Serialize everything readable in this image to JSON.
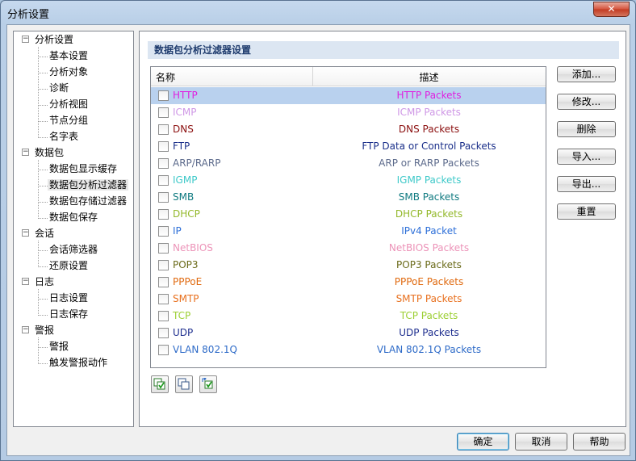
{
  "window": {
    "title": "分析设置",
    "close_label": "✕"
  },
  "tree": {
    "groups": [
      {
        "label": "分析设置",
        "children": [
          "基本设置",
          "分析对象",
          "诊断",
          "分析视图",
          "节点分组",
          "名字表"
        ]
      },
      {
        "label": "数据包",
        "children": [
          "数据包显示缓存",
          "数据包分析过滤器",
          "数据包存储过滤器",
          "数据包保存"
        ]
      },
      {
        "label": "会话",
        "children": [
          "会话筛选器",
          "还原设置"
        ]
      },
      {
        "label": "日志",
        "children": [
          "日志设置",
          "日志保存"
        ]
      },
      {
        "label": "警报",
        "children": [
          "警报",
          "触发警报动作"
        ]
      }
    ],
    "selected": "数据包分析过滤器"
  },
  "panel": {
    "header": "数据包分析过滤器设置",
    "columns": {
      "name": "名称",
      "desc": "描述"
    },
    "rows": [
      {
        "name": "HTTP",
        "desc": "HTTP Packets",
        "color": "#e020e0",
        "selected": true
      },
      {
        "name": "ICMP",
        "desc": "ICMP Packets",
        "color": "#cf98e6"
      },
      {
        "name": "DNS",
        "desc": "DNS Packets",
        "color": "#8b0f0f"
      },
      {
        "name": "FTP",
        "desc": "FTP Data or Control Packets",
        "color": "#1a2f8a"
      },
      {
        "name": "ARP/RARP",
        "desc": "ARP or RARP Packets",
        "color": "#5d6b8c"
      },
      {
        "name": "IGMP",
        "desc": "IGMP Packets",
        "color": "#3fc9c9"
      },
      {
        "name": "SMB",
        "desc": "SMB Packets",
        "color": "#0f7a80"
      },
      {
        "name": "DHCP",
        "desc": "DHCP Packets",
        "color": "#93b82a"
      },
      {
        "name": "IP",
        "desc": "IPv4 Packet",
        "color": "#2d6fd8"
      },
      {
        "name": "NetBIOS",
        "desc": "NetBIOS Packets",
        "color": "#ec93b8"
      },
      {
        "name": "POP3",
        "desc": "POP3 Packets",
        "color": "#6b6b1a"
      },
      {
        "name": "PPPoE",
        "desc": "PPPoE Packets",
        "color": "#e06a10"
      },
      {
        "name": "SMTP",
        "desc": "SMTP Packets",
        "color": "#e8701e"
      },
      {
        "name": "TCP",
        "desc": "TCP Packets",
        "color": "#9ccf33"
      },
      {
        "name": "UDP",
        "desc": "UDP Packets",
        "color": "#1f2f8f"
      },
      {
        "name": "VLAN 802.1Q",
        "desc": "VLAN 802.1Q Packets",
        "color": "#2e6bc8"
      }
    ],
    "buttons": [
      "添加...",
      "修改...",
      "删除",
      "导入...",
      "导出...",
      "重置"
    ],
    "toolbar_icons": [
      "select-all-icon",
      "deselect-all-icon",
      "invert-selection-icon"
    ]
  },
  "footer": {
    "ok": "确定",
    "cancel": "取消",
    "help": "帮助"
  }
}
